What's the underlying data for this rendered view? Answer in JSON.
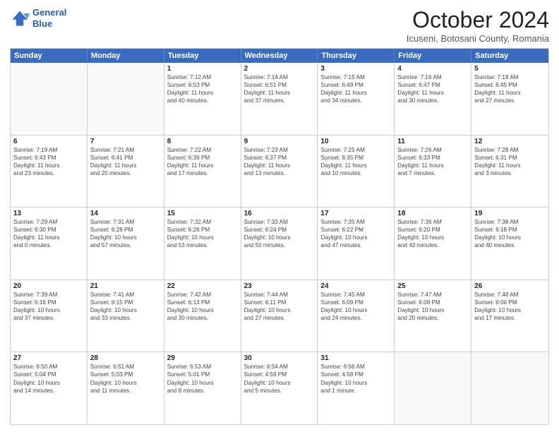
{
  "header": {
    "logo_line1": "General",
    "logo_line2": "Blue",
    "month": "October 2024",
    "location": "Icuseni, Botosani County, Romania"
  },
  "days_of_week": [
    "Sunday",
    "Monday",
    "Tuesday",
    "Wednesday",
    "Thursday",
    "Friday",
    "Saturday"
  ],
  "weeks": [
    [
      {
        "day": "",
        "lines": []
      },
      {
        "day": "",
        "lines": []
      },
      {
        "day": "1",
        "lines": [
          "Sunrise: 7:12 AM",
          "Sunset: 6:53 PM",
          "Daylight: 11 hours",
          "and 40 minutes."
        ]
      },
      {
        "day": "2",
        "lines": [
          "Sunrise: 7:14 AM",
          "Sunset: 6:51 PM",
          "Daylight: 11 hours",
          "and 37 minutes."
        ]
      },
      {
        "day": "3",
        "lines": [
          "Sunrise: 7:15 AM",
          "Sunset: 6:49 PM",
          "Daylight: 11 hours",
          "and 34 minutes."
        ]
      },
      {
        "day": "4",
        "lines": [
          "Sunrise: 7:16 AM",
          "Sunset: 6:47 PM",
          "Daylight: 11 hours",
          "and 30 minutes."
        ]
      },
      {
        "day": "5",
        "lines": [
          "Sunrise: 7:18 AM",
          "Sunset: 6:45 PM",
          "Daylight: 11 hours",
          "and 27 minutes."
        ]
      }
    ],
    [
      {
        "day": "6",
        "lines": [
          "Sunrise: 7:19 AM",
          "Sunset: 6:43 PM",
          "Daylight: 11 hours",
          "and 23 minutes."
        ]
      },
      {
        "day": "7",
        "lines": [
          "Sunrise: 7:21 AM",
          "Sunset: 6:41 PM",
          "Daylight: 11 hours",
          "and 20 minutes."
        ]
      },
      {
        "day": "8",
        "lines": [
          "Sunrise: 7:22 AM",
          "Sunset: 6:39 PM",
          "Daylight: 11 hours",
          "and 17 minutes."
        ]
      },
      {
        "day": "9",
        "lines": [
          "Sunrise: 7:23 AM",
          "Sunset: 6:37 PM",
          "Daylight: 11 hours",
          "and 13 minutes."
        ]
      },
      {
        "day": "10",
        "lines": [
          "Sunrise: 7:25 AM",
          "Sunset: 6:35 PM",
          "Daylight: 11 hours",
          "and 10 minutes."
        ]
      },
      {
        "day": "11",
        "lines": [
          "Sunrise: 7:26 AM",
          "Sunset: 6:33 PM",
          "Daylight: 11 hours",
          "and 7 minutes."
        ]
      },
      {
        "day": "12",
        "lines": [
          "Sunrise: 7:28 AM",
          "Sunset: 6:31 PM",
          "Daylight: 11 hours",
          "and 3 minutes."
        ]
      }
    ],
    [
      {
        "day": "13",
        "lines": [
          "Sunrise: 7:29 AM",
          "Sunset: 6:30 PM",
          "Daylight: 11 hours",
          "and 0 minutes."
        ]
      },
      {
        "day": "14",
        "lines": [
          "Sunrise: 7:31 AM",
          "Sunset: 6:28 PM",
          "Daylight: 10 hours",
          "and 57 minutes."
        ]
      },
      {
        "day": "15",
        "lines": [
          "Sunrise: 7:32 AM",
          "Sunset: 6:26 PM",
          "Daylight: 10 hours",
          "and 53 minutes."
        ]
      },
      {
        "day": "16",
        "lines": [
          "Sunrise: 7:33 AM",
          "Sunset: 6:24 PM",
          "Daylight: 10 hours",
          "and 50 minutes."
        ]
      },
      {
        "day": "17",
        "lines": [
          "Sunrise: 7:35 AM",
          "Sunset: 6:22 PM",
          "Daylight: 10 hours",
          "and 47 minutes."
        ]
      },
      {
        "day": "18",
        "lines": [
          "Sunrise: 7:36 AM",
          "Sunset: 6:20 PM",
          "Daylight: 10 hours",
          "and 43 minutes."
        ]
      },
      {
        "day": "19",
        "lines": [
          "Sunrise: 7:38 AM",
          "Sunset: 6:18 PM",
          "Daylight: 10 hours",
          "and 40 minutes."
        ]
      }
    ],
    [
      {
        "day": "20",
        "lines": [
          "Sunrise: 7:39 AM",
          "Sunset: 6:16 PM",
          "Daylight: 10 hours",
          "and 37 minutes."
        ]
      },
      {
        "day": "21",
        "lines": [
          "Sunrise: 7:41 AM",
          "Sunset: 6:15 PM",
          "Daylight: 10 hours",
          "and 33 minutes."
        ]
      },
      {
        "day": "22",
        "lines": [
          "Sunrise: 7:42 AM",
          "Sunset: 6:13 PM",
          "Daylight: 10 hours",
          "and 30 minutes."
        ]
      },
      {
        "day": "23",
        "lines": [
          "Sunrise: 7:44 AM",
          "Sunset: 6:11 PM",
          "Daylight: 10 hours",
          "and 27 minutes."
        ]
      },
      {
        "day": "24",
        "lines": [
          "Sunrise: 7:45 AM",
          "Sunset: 6:09 PM",
          "Daylight: 10 hours",
          "and 24 minutes."
        ]
      },
      {
        "day": "25",
        "lines": [
          "Sunrise: 7:47 AM",
          "Sunset: 6:08 PM",
          "Daylight: 10 hours",
          "and 20 minutes."
        ]
      },
      {
        "day": "26",
        "lines": [
          "Sunrise: 7:48 AM",
          "Sunset: 6:06 PM",
          "Daylight: 10 hours",
          "and 17 minutes."
        ]
      }
    ],
    [
      {
        "day": "27",
        "lines": [
          "Sunrise: 6:50 AM",
          "Sunset: 5:04 PM",
          "Daylight: 10 hours",
          "and 14 minutes."
        ]
      },
      {
        "day": "28",
        "lines": [
          "Sunrise: 6:51 AM",
          "Sunset: 5:03 PM",
          "Daylight: 10 hours",
          "and 11 minutes."
        ]
      },
      {
        "day": "29",
        "lines": [
          "Sunrise: 6:53 AM",
          "Sunset: 5:01 PM",
          "Daylight: 10 hours",
          "and 8 minutes."
        ]
      },
      {
        "day": "30",
        "lines": [
          "Sunrise: 6:54 AM",
          "Sunset: 4:59 PM",
          "Daylight: 10 hours",
          "and 5 minutes."
        ]
      },
      {
        "day": "31",
        "lines": [
          "Sunrise: 6:56 AM",
          "Sunset: 4:58 PM",
          "Daylight: 10 hours",
          "and 1 minute."
        ]
      },
      {
        "day": "",
        "lines": []
      },
      {
        "day": "",
        "lines": []
      }
    ]
  ]
}
